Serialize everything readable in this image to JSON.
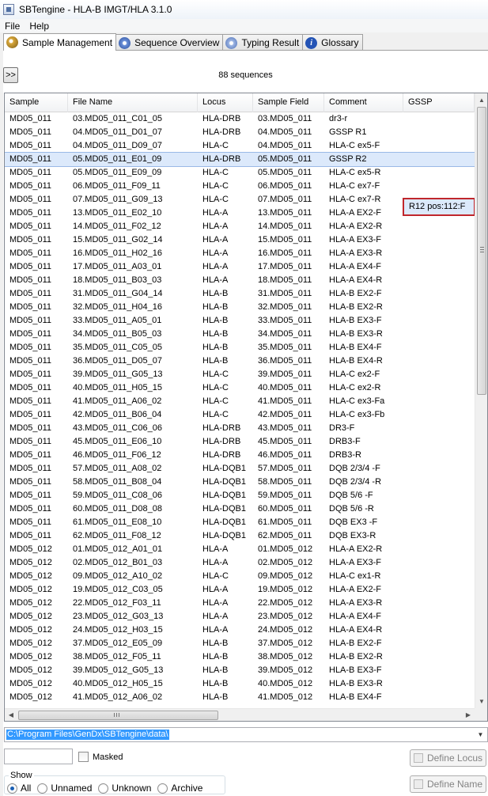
{
  "window": {
    "title": "SBTengine - HLA-B IMGT/HLA 3.1.0"
  },
  "menu": [
    "File",
    "Help"
  ],
  "tabs": [
    {
      "label": "Sample Management",
      "icon": "sample-icon",
      "active": true
    },
    {
      "label": "Sequence Overview",
      "icon": "sequence-icon",
      "active": false
    },
    {
      "label": "Typing Result",
      "icon": "typing-icon",
      "active": false
    },
    {
      "label": "Glossary",
      "icon": "info-icon",
      "active": false
    }
  ],
  "toolbar": {
    "expand_label": ">>",
    "sequence_count": "88 sequences"
  },
  "table": {
    "columns": [
      "Sample",
      "File Name",
      "Locus",
      "Sample Field",
      "Comment",
      "GSSP"
    ],
    "selected_index": 3,
    "flag_text": "R12 pos:112:F",
    "rows": [
      [
        "MD05_011",
        "03.MD05_011_C01_05",
        "HLA-DRB",
        "03.MD05_011",
        "dr3-r",
        ""
      ],
      [
        "MD05_011",
        "04.MD05_011_D01_07",
        "HLA-DRB",
        "04.MD05_011",
        "GSSP R1",
        ""
      ],
      [
        "MD05_011",
        "04.MD05_011_D09_07",
        "HLA-C",
        "04.MD05_011",
        "HLA-C ex5-F",
        ""
      ],
      [
        "MD05_011",
        "05.MD05_011_E01_09",
        "HLA-DRB",
        "05.MD05_011",
        "GSSP R2",
        ""
      ],
      [
        "MD05_011",
        "05.MD05_011_E09_09",
        "HLA-C",
        "05.MD05_011",
        "HLA-C ex5-R",
        ""
      ],
      [
        "MD05_011",
        "06.MD05_011_F09_11",
        "HLA-C",
        "06.MD05_011",
        "HLA-C ex7-F",
        ""
      ],
      [
        "MD05_011",
        "07.MD05_011_G09_13",
        "HLA-C",
        "07.MD05_011",
        "HLA-C ex7-R",
        ""
      ],
      [
        "MD05_011",
        "13.MD05_011_E02_10",
        "HLA-A",
        "13.MD05_011",
        "HLA-A EX2-F",
        ""
      ],
      [
        "MD05_011",
        "14.MD05_011_F02_12",
        "HLA-A",
        "14.MD05_011",
        "HLA-A EX2-R",
        ""
      ],
      [
        "MD05_011",
        "15.MD05_011_G02_14",
        "HLA-A",
        "15.MD05_011",
        "HLA-A EX3-F",
        ""
      ],
      [
        "MD05_011",
        "16.MD05_011_H02_16",
        "HLA-A",
        "16.MD05_011",
        "HLA-A EX3-R",
        ""
      ],
      [
        "MD05_011",
        "17.MD05_011_A03_01",
        "HLA-A",
        "17.MD05_011",
        "HLA-A EX4-F",
        ""
      ],
      [
        "MD05_011",
        "18.MD05_011_B03_03",
        "HLA-A",
        "18.MD05_011",
        "HLA-A EX4-R",
        ""
      ],
      [
        "MD05_011",
        "31.MD05_011_G04_14",
        "HLA-B",
        "31.MD05_011",
        "HLA-B EX2-F",
        ""
      ],
      [
        "MD05_011",
        "32.MD05_011_H04_16",
        "HLA-B",
        "32.MD05_011",
        "HLA-B EX2-R",
        ""
      ],
      [
        "MD05_011",
        "33.MD05_011_A05_01",
        "HLA-B",
        "33.MD05_011",
        "HLA-B EX3-F",
        ""
      ],
      [
        "MD05_011",
        "34.MD05_011_B05_03",
        "HLA-B",
        "34.MD05_011",
        "HLA-B EX3-R",
        ""
      ],
      [
        "MD05_011",
        "35.MD05_011_C05_05",
        "HLA-B",
        "35.MD05_011",
        "HLA-B EX4-F",
        ""
      ],
      [
        "MD05_011",
        "36.MD05_011_D05_07",
        "HLA-B",
        "36.MD05_011",
        "HLA-B EX4-R",
        ""
      ],
      [
        "MD05_011",
        "39.MD05_011_G05_13",
        "HLA-C",
        "39.MD05_011",
        "HLA-C ex2-F",
        ""
      ],
      [
        "MD05_011",
        "40.MD05_011_H05_15",
        "HLA-C",
        "40.MD05_011",
        "HLA-C ex2-R",
        ""
      ],
      [
        "MD05_011",
        "41.MD05_011_A06_02",
        "HLA-C",
        "41.MD05_011",
        "HLA-C ex3-Fa",
        ""
      ],
      [
        "MD05_011",
        "42.MD05_011_B06_04",
        "HLA-C",
        "42.MD05_011",
        "HLA-C ex3-Fb",
        ""
      ],
      [
        "MD05_011",
        "43.MD05_011_C06_06",
        "HLA-DRB",
        "43.MD05_011",
        "DR3-F",
        ""
      ],
      [
        "MD05_011",
        "45.MD05_011_E06_10",
        "HLA-DRB",
        "45.MD05_011",
        "DRB3-F",
        ""
      ],
      [
        "MD05_011",
        "46.MD05_011_F06_12",
        "HLA-DRB",
        "46.MD05_011",
        "DRB3-R",
        ""
      ],
      [
        "MD05_011",
        "57.MD05_011_A08_02",
        "HLA-DQB1",
        "57.MD05_011",
        "DQB 2/3/4  -F",
        ""
      ],
      [
        "MD05_011",
        "58.MD05_011_B08_04",
        "HLA-DQB1",
        "58.MD05_011",
        "DQB 2/3/4  -R",
        ""
      ],
      [
        "MD05_011",
        "59.MD05_011_C08_06",
        "HLA-DQB1",
        "59.MD05_011",
        "DQB 5/6  -F",
        ""
      ],
      [
        "MD05_011",
        "60.MD05_011_D08_08",
        "HLA-DQB1",
        "60.MD05_011",
        "DQB 5/6  -R",
        ""
      ],
      [
        "MD05_011",
        "61.MD05_011_E08_10",
        "HLA-DQB1",
        "61.MD05_011",
        "DQB EX3  -F",
        ""
      ],
      [
        "MD05_011",
        "62.MD05_011_F08_12",
        "HLA-DQB1",
        "62.MD05_011",
        "DQB EX3-R",
        ""
      ],
      [
        "MD05_012",
        "01.MD05_012_A01_01",
        "HLA-A",
        "01.MD05_012",
        "HLA-A EX2-R",
        ""
      ],
      [
        "MD05_012",
        "02.MD05_012_B01_03",
        "HLA-A",
        "02.MD05_012",
        "HLA-A EX3-F",
        ""
      ],
      [
        "MD05_012",
        "09.MD05_012_A10_02",
        "HLA-C",
        "09.MD05_012",
        "HLA-C ex1-R",
        ""
      ],
      [
        "MD05_012",
        "19.MD05_012_C03_05",
        "HLA-A",
        "19.MD05_012",
        "HLA-A EX2-F",
        ""
      ],
      [
        "MD05_012",
        "22.MD05_012_F03_11",
        "HLA-A",
        "22.MD05_012",
        "HLA-A EX3-R",
        ""
      ],
      [
        "MD05_012",
        "23.MD05_012_G03_13",
        "HLA-A",
        "23.MD05_012",
        "HLA-A EX4-F",
        ""
      ],
      [
        "MD05_012",
        "24.MD05_012_H03_15",
        "HLA-A",
        "24.MD05_012",
        "HLA-A EX4-R",
        ""
      ],
      [
        "MD05_012",
        "37.MD05_012_E05_09",
        "HLA-B",
        "37.MD05_012",
        "HLA-B EX2-F",
        ""
      ],
      [
        "MD05_012",
        "38.MD05_012_F05_11",
        "HLA-B",
        "38.MD05_012",
        "HLA-B EX2-R",
        ""
      ],
      [
        "MD05_012",
        "39.MD05_012_G05_13",
        "HLA-B",
        "39.MD05_012",
        "HLA-B EX3-F",
        ""
      ],
      [
        "MD05_012",
        "40.MD05_012_H05_15",
        "HLA-B",
        "40.MD05_012",
        "HLA-B EX3-R",
        ""
      ],
      [
        "MD05_012",
        "41.MD05_012_A06_02",
        "HLA-B",
        "41.MD05_012",
        "HLA-B EX4-F",
        ""
      ]
    ]
  },
  "path": {
    "value": "C:\\Program Files\\GenDx\\SBTengine\\data\\"
  },
  "filter": {
    "value": "",
    "masked_label": "Masked",
    "masked_checked": false
  },
  "buttons": {
    "define_locus": "Define Locus",
    "define_name": "Define Name"
  },
  "show": {
    "legend": "Show",
    "options": [
      "All",
      "Unnamed",
      "Unknown",
      "Archive"
    ],
    "selected": "All"
  },
  "icons": {
    "scroll_up": "▲",
    "scroll_down": "▼",
    "scroll_left": "◀",
    "scroll_right": "▶",
    "combo_arrow": "▼"
  },
  "colors": {
    "selection": "#dce9fb",
    "flag_border": "#c0262c",
    "path_highlight": "#3399ff"
  }
}
